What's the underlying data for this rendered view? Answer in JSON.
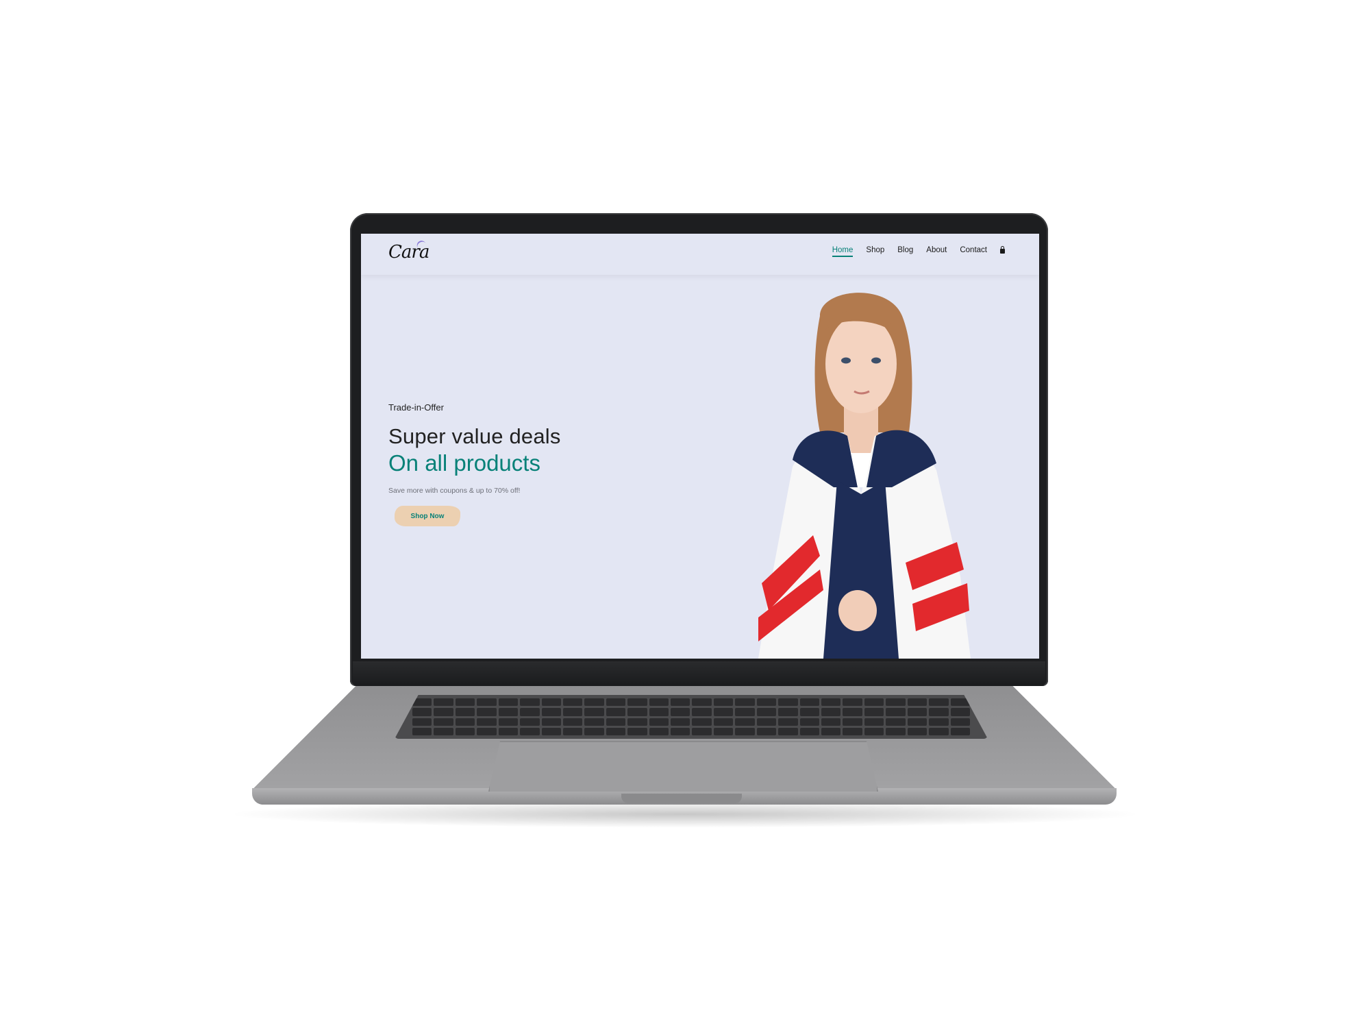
{
  "brand": {
    "logo_text": "Cara"
  },
  "nav": {
    "items": [
      {
        "label": "Home",
        "active": true
      },
      {
        "label": "Shop",
        "active": false
      },
      {
        "label": "Blog",
        "active": false
      },
      {
        "label": "About",
        "active": false
      },
      {
        "label": "Contact",
        "active": false
      }
    ],
    "cart_icon": "shopping-bag-icon"
  },
  "hero": {
    "kicker": "Trade-in-Offer",
    "headline": "Super value deals",
    "highlight": "On all products",
    "subtext": "Save more with coupons & up to 70% off!",
    "cta_label": "Shop Now"
  },
  "colors": {
    "accent": "#088178",
    "hero_bg": "#e3e6f3",
    "cta_bg": "#ecd0b1"
  }
}
